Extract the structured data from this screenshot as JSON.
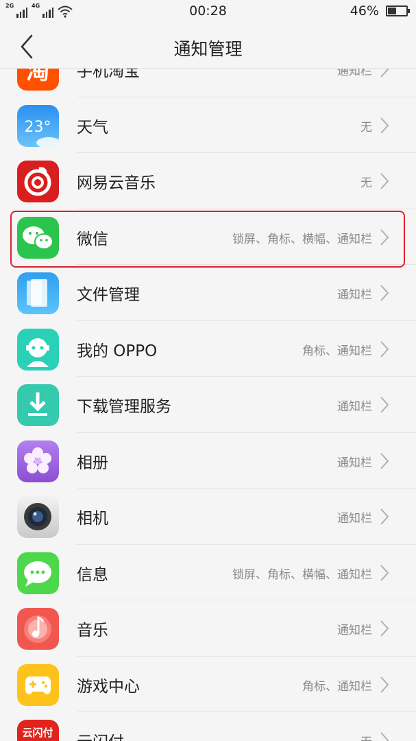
{
  "status_bar": {
    "sim1_type": "2G",
    "sim2_type": "4G",
    "time": "00:28",
    "battery_percent": "46%",
    "battery_level": 0.46
  },
  "header": {
    "title": "通知管理"
  },
  "apps": [
    {
      "name": "手机淘宝",
      "status": "通知栏",
      "icon": "taobao-icon"
    },
    {
      "name": "天气",
      "status": "无",
      "icon": "weather-icon",
      "icon_text": "23°"
    },
    {
      "name": "网易云音乐",
      "status": "无",
      "icon": "netease-music-icon"
    },
    {
      "name": "微信",
      "status": "锁屏、角标、横幅、通知栏",
      "icon": "wechat-icon"
    },
    {
      "name": "文件管理",
      "status": "通知栏",
      "icon": "file-manager-icon"
    },
    {
      "name": "我的 OPPO",
      "status": "角标、通知栏",
      "icon": "my-oppo-icon"
    },
    {
      "name": "下载管理服务",
      "status": "通知栏",
      "icon": "download-icon"
    },
    {
      "name": "相册",
      "status": "通知栏",
      "icon": "photos-icon"
    },
    {
      "name": "相机",
      "status": "通知栏",
      "icon": "camera-icon"
    },
    {
      "name": "信息",
      "status": "锁屏、角标、横幅、通知栏",
      "icon": "messages-icon"
    },
    {
      "name": "音乐",
      "status": "通知栏",
      "icon": "music-icon"
    },
    {
      "name": "游戏中心",
      "status": "角标、通知栏",
      "icon": "game-center-icon"
    },
    {
      "name": "云闪付",
      "status": "无",
      "icon": "unionpay-icon"
    }
  ],
  "colors": {
    "highlight": "#d9232d",
    "taobao": "#ff5000",
    "weather": "#3ba4f2",
    "netease": "#d81e1e",
    "wechat": "#2bc54d",
    "files": "#3aa8f5",
    "oppo": "#2ad1b7",
    "download": "#35c9ae",
    "photos": "#a46be0",
    "messages": "#4cd84a",
    "music": "#f2574f",
    "game": "#ffc21a",
    "unionpay": "#e0231b"
  }
}
